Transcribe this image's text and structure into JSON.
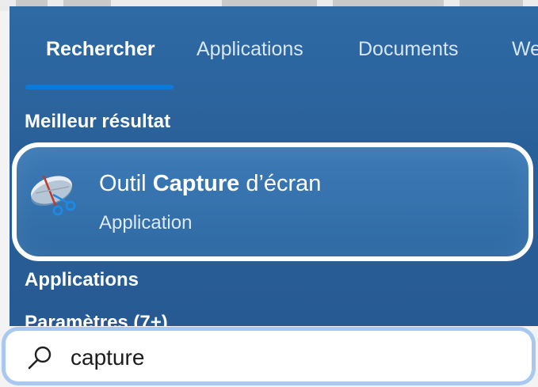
{
  "tabs": [
    {
      "label": "Rechercher",
      "active": true
    },
    {
      "label": "Applications",
      "active": false
    },
    {
      "label": "Documents",
      "active": false
    },
    {
      "label": "We",
      "active": false
    }
  ],
  "best_match": {
    "heading": "Meilleur résultat",
    "title_prefix": "Outil ",
    "title_bold": "Capture",
    "title_suffix": " d’écran",
    "subtitle": "Application",
    "icon": "snipping-tool-icon"
  },
  "sections": {
    "applications": "Applications",
    "settings": "Paramètres (7+)"
  },
  "search": {
    "query": "capture",
    "icon": "search-icon"
  },
  "colors": {
    "panel": "#2c64a0",
    "tab_underline": "#0a7bdc",
    "highlight_border": "#ffffff",
    "search_focus_ring": "#a9c8ef"
  }
}
